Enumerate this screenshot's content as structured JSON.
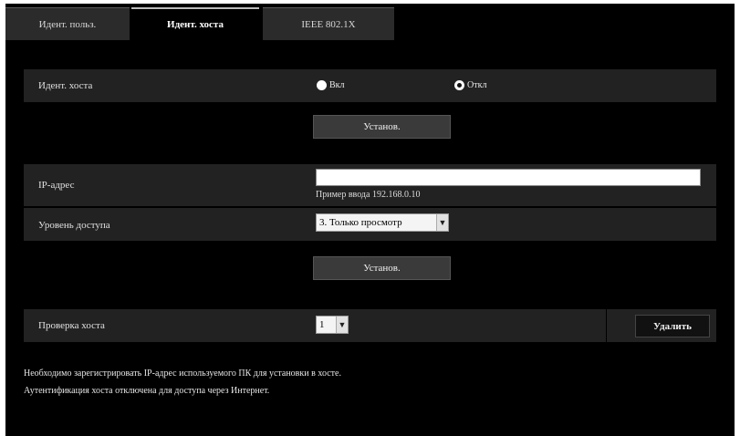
{
  "tabs": [
    {
      "label": "Идент. польз.",
      "active": false
    },
    {
      "label": "Идент. хоста",
      "active": true
    },
    {
      "label": "IEEE 802.1X",
      "active": false
    }
  ],
  "host_auth": {
    "label": "Идент. хоста",
    "options": [
      "Вкл",
      "Откл"
    ],
    "selected": "Откл",
    "set_button": "Установ."
  },
  "ip_form": {
    "ip_label": "IP-адрес",
    "ip_value": "",
    "ip_hint": "Пример ввода 192.168.0.10",
    "access_label": "Уровень доступа",
    "access_value": "3. Только просмотр",
    "set_button": "Установ."
  },
  "host_check": {
    "label": "Проверка хоста",
    "value": "1",
    "delete_button": "Удалить"
  },
  "notes": [
    "Необходимо зарегистрировать IP-адрес используемого ПК для установки в хосте.",
    "Аутентификация хоста отключена для доступа через Интернет."
  ],
  "icons": {
    "dropdown": "chevron-down-icon",
    "radio": "radio-icon"
  }
}
